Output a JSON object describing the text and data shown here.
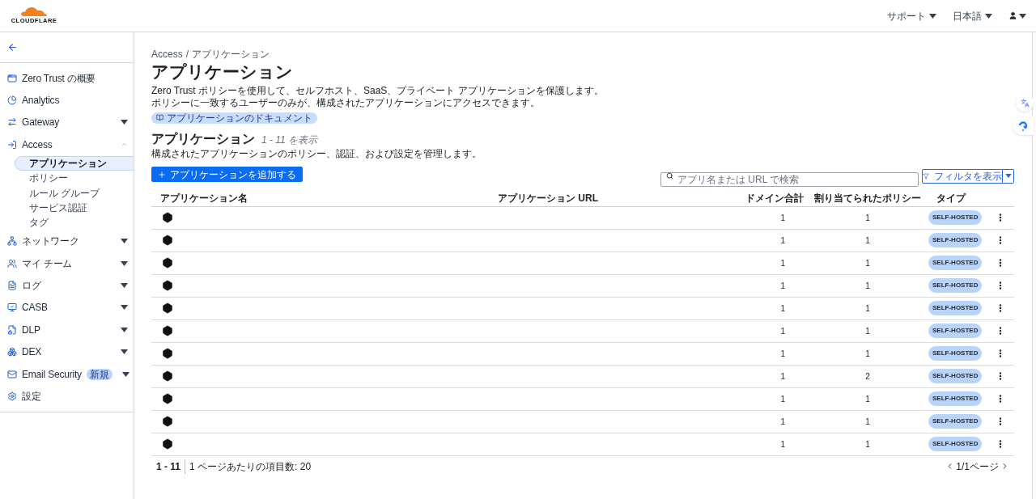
{
  "header": {
    "logo_text": "CLOUDFLARE",
    "menus": [
      {
        "label": "サポート"
      },
      {
        "label": "日本語"
      }
    ]
  },
  "sidebar": {
    "items": [
      {
        "label": "Zero Trust の概要",
        "selected": false
      },
      {
        "label": "Analytics",
        "selected": false
      },
      {
        "label": "Gateway",
        "selected": false,
        "expanded": false
      },
      {
        "label": "Access",
        "selected": false,
        "expanded": true,
        "children": [
          {
            "label": "アプリケーション",
            "selected": true
          },
          {
            "label": "ポリシー",
            "selected": false
          },
          {
            "label": "ルール グループ",
            "selected": false
          },
          {
            "label": "サービス認証",
            "selected": false
          },
          {
            "label": "タグ",
            "selected": false
          }
        ]
      },
      {
        "label": "ネットワーク",
        "selected": false,
        "expanded": false
      },
      {
        "label": "マイ チーム",
        "selected": false,
        "expanded": false
      },
      {
        "label": "ログ",
        "selected": false,
        "expanded": false
      },
      {
        "label": "CASB",
        "selected": false,
        "expanded": false
      },
      {
        "label": "DLP",
        "selected": false,
        "expanded": false
      },
      {
        "label": "DEX",
        "selected": false,
        "expanded": false
      },
      {
        "label": "Email Security",
        "badge": "新規",
        "selected": false,
        "expanded": false
      },
      {
        "label": "設定",
        "selected": false
      }
    ]
  },
  "breadcrumb": [
    "Access",
    "アプリケーション"
  ],
  "breadcrumb_separator": "/",
  "page_title": "アプリケーション",
  "description": "Zero Trust ポリシーを使用して、セルフホスト、SaaS、プライベート アプリケーションを保護します。ポリシーに一致するユーザーのみが、構成されたアプリケーションにアクセスできます。",
  "doc_link": "アプリケーションのドキュメント",
  "section": {
    "title": "アプリケーション",
    "count": "1 - 11 を表示",
    "subtitle": "構成されたアプリケーションのポリシー、認証、および設定を管理します。"
  },
  "add_button": "アプリケーションを追加する",
  "search": {
    "placeholder": "アプリ名または URL で検索"
  },
  "filter_button": "フィルタを表示",
  "table": {
    "columns": [
      "アプリケーション名",
      "アプリケーション URL",
      "ドメイン合計",
      "割り当てられたポリシー",
      "タイプ"
    ],
    "rows": [
      {
        "domains": "1",
        "policies": "1",
        "type": "SELF-HOSTED"
      },
      {
        "domains": "1",
        "policies": "1",
        "type": "SELF-HOSTED"
      },
      {
        "domains": "1",
        "policies": "1",
        "type": "SELF-HOSTED"
      },
      {
        "domains": "1",
        "policies": "1",
        "type": "SELF-HOSTED"
      },
      {
        "domains": "1",
        "policies": "1",
        "type": "SELF-HOSTED"
      },
      {
        "domains": "1",
        "policies": "1",
        "type": "SELF-HOSTED"
      },
      {
        "domains": "1",
        "policies": "1",
        "type": "SELF-HOSTED"
      },
      {
        "domains": "1",
        "policies": "2",
        "type": "SELF-HOSTED"
      },
      {
        "domains": "1",
        "policies": "1",
        "type": "SELF-HOSTED"
      },
      {
        "domains": "1",
        "policies": "1",
        "type": "SELF-HOSTED"
      },
      {
        "domains": "1",
        "policies": "1",
        "type": "SELF-HOSTED"
      }
    ]
  },
  "footer": {
    "range": "1 - 11",
    "per_page": "1 ページあたりの項目数: 20",
    "pages": "1/1ページ"
  }
}
